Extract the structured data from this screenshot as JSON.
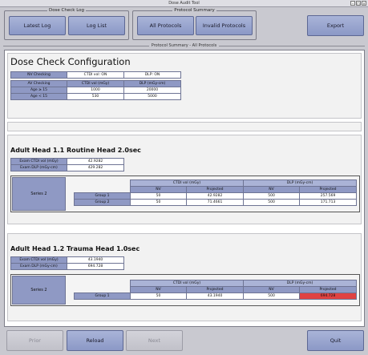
{
  "window": {
    "title": "Dose Audit Tool"
  },
  "toolbar": {
    "dose_check_log_label": "Dose Check Log",
    "latest_log": "Latest Log",
    "log_list": "Log List",
    "protocol_summary_label": "Protocol Summary",
    "all_protocols": "All Protocols",
    "invalid_protocols": "Invalid Protocols",
    "export": "Export"
  },
  "section_title": "Protocol Summary - All Protocols",
  "config": {
    "title": "Dose Check Configuration",
    "nv_checking_label": "NV Checking",
    "nv_ctdi": "CTDI vol: ON",
    "nv_dlp": "DLP: ON",
    "av_checking_label": "AV Checking",
    "ctdi_header": "CTDI vol (mGy)",
    "dlp_header": "DLP (mGy-cm)",
    "rows": [
      {
        "label": "Age ≥ 15",
        "ctdi": "1000",
        "dlp": "20000"
      },
      {
        "label": "Age < 15",
        "ctdi": "530",
        "dlp": "5000"
      }
    ]
  },
  "protocols": [
    {
      "title": "Adult Head 1.1 Routine Head 2.0sec",
      "exam_ctdi_label": "Exam CTDI vol (mGy)",
      "exam_ctdi": "42.9282",
      "exam_dlp_label": "Exam DLP (mGy-cm)",
      "exam_dlp": "429.282",
      "series_label": "Series 2",
      "ctdi_header": "CTDI vol (mGy)",
      "dlp_header": "DLP (mGy-cm)",
      "nv_header": "NV",
      "projected_header": "Projected",
      "groups": [
        {
          "label": "Group 1",
          "ctdi_nv": "50",
          "ctdi_proj": "42.9282",
          "dlp_nv": "500",
          "dlp_proj": "257.569"
        },
        {
          "label": "Group 2",
          "ctdi_nv": "50",
          "ctdi_proj": "71.4661",
          "dlp_nv": "500",
          "dlp_proj": "171.713"
        }
      ]
    },
    {
      "title": "Adult Head 1.2 Trauma Head 1.0sec",
      "exam_ctdi_label": "Exam CTDI vol (mGy)",
      "exam_ctdi": "43.1940",
      "exam_dlp_label": "Exam DLP (mGy-cm)",
      "exam_dlp": "694.728",
      "series_label": "Series 2",
      "ctdi_header": "CTDI vol (mGy)",
      "dlp_header": "DLP (mGy-cm)",
      "nv_header": "NV",
      "projected_header": "Projected",
      "groups": [
        {
          "label": "Group 1",
          "ctdi_nv": "50",
          "ctdi_proj": "43.1940",
          "dlp_nv": "500",
          "dlp_proj": "694.728"
        }
      ]
    }
  ],
  "footer": {
    "prior": "Prior",
    "reload": "Reload",
    "next": "Next",
    "quit": "Quit"
  },
  "colors": {
    "button": "#8b98c6",
    "label_cell": "#8f99c4",
    "alert": "#e04242"
  }
}
